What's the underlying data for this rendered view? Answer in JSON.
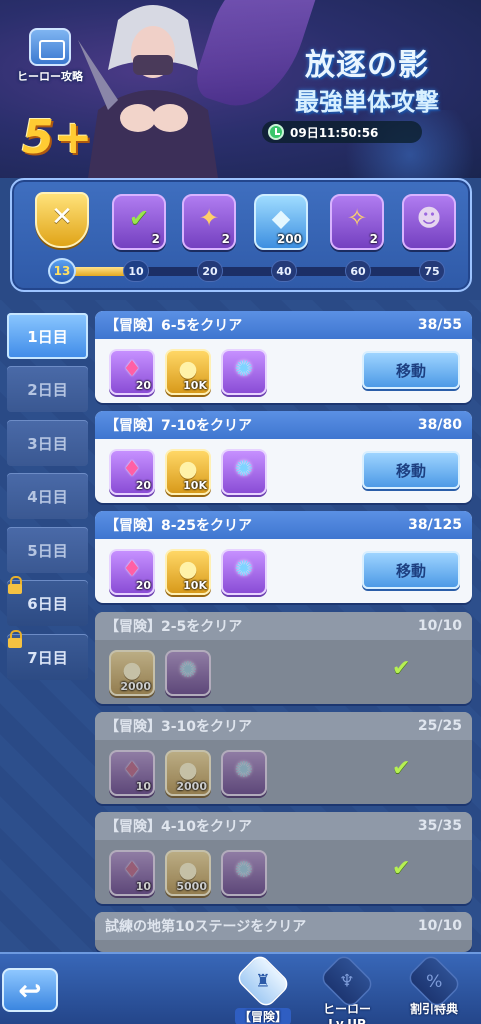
{
  "banner": {
    "hero_guide_label": "ヒーロー攻略",
    "rarity_badge": "5+",
    "event_title": "放逐の影",
    "event_subtitle": "最強単体攻撃",
    "timer": "09日11:50:56"
  },
  "progress": {
    "current_score": "13",
    "max_score": 75,
    "rewards": [
      {
        "icon": "check-icon",
        "count": "2"
      },
      {
        "icon": "scroll-icon",
        "count": "2"
      },
      {
        "icon": "diamond-icon",
        "count": "200"
      },
      {
        "icon": "summon-scroll-icon",
        "count": "2"
      },
      {
        "icon": "hero-portrait-icon",
        "count": ""
      }
    ],
    "milestones": [
      "10",
      "20",
      "40",
      "60",
      "75"
    ]
  },
  "day_tabs": [
    {
      "label": "1日目",
      "state": "active"
    },
    {
      "label": "2日目",
      "state": "normal"
    },
    {
      "label": "3日目",
      "state": "normal"
    },
    {
      "label": "4日目",
      "state": "normal"
    },
    {
      "label": "5日目",
      "state": "normal"
    },
    {
      "label": "6日目",
      "state": "locked"
    },
    {
      "label": "7日目",
      "state": "locked"
    }
  ],
  "tasks": [
    {
      "title": "【冒険】6-5をクリア",
      "progress": "38/55",
      "done": false,
      "items": [
        {
          "icon": "gem-icon",
          "qty": "20"
        },
        {
          "icon": "coin-icon",
          "qty": "10K"
        },
        {
          "icon": "orb-icon",
          "qty": ""
        }
      ],
      "button": "移動"
    },
    {
      "title": "【冒険】7-10をクリア",
      "progress": "38/80",
      "done": false,
      "items": [
        {
          "icon": "gem-icon",
          "qty": "20"
        },
        {
          "icon": "coin-icon",
          "qty": "10K"
        },
        {
          "icon": "orb-icon",
          "qty": ""
        }
      ],
      "button": "移動"
    },
    {
      "title": "【冒険】8-25をクリア",
      "progress": "38/125",
      "done": false,
      "items": [
        {
          "icon": "gem-icon",
          "qty": "20"
        },
        {
          "icon": "coin-icon",
          "qty": "10K"
        },
        {
          "icon": "orb-icon",
          "qty": ""
        }
      ],
      "button": "移動"
    },
    {
      "title": "【冒険】2-5をクリア",
      "progress": "10/10",
      "done": true,
      "items": [
        {
          "icon": "coin-icon",
          "qty": "2000"
        },
        {
          "icon": "orb-icon",
          "qty": ""
        }
      ]
    },
    {
      "title": "【冒険】3-10をクリア",
      "progress": "25/25",
      "done": true,
      "items": [
        {
          "icon": "gem-icon",
          "qty": "10"
        },
        {
          "icon": "coin-icon",
          "qty": "2000"
        },
        {
          "icon": "orb-icon",
          "qty": ""
        }
      ]
    },
    {
      "title": "【冒険】4-10をクリア",
      "progress": "35/35",
      "done": true,
      "items": [
        {
          "icon": "gem-icon",
          "qty": "10"
        },
        {
          "icon": "coin-icon",
          "qty": "5000"
        },
        {
          "icon": "orb-icon",
          "qty": ""
        }
      ]
    },
    {
      "title": "試練の地第10ステージをクリア",
      "progress": "10/10",
      "done": true,
      "items": []
    }
  ],
  "bottom_nav": [
    {
      "label": "【冒険】",
      "icon": "castle-icon",
      "active": true
    },
    {
      "label": "ヒーローLv.UP",
      "icon": "hero-emblem-icon",
      "active": false
    },
    {
      "label": "割引特典",
      "icon": "discount-icon",
      "active": false
    }
  ]
}
